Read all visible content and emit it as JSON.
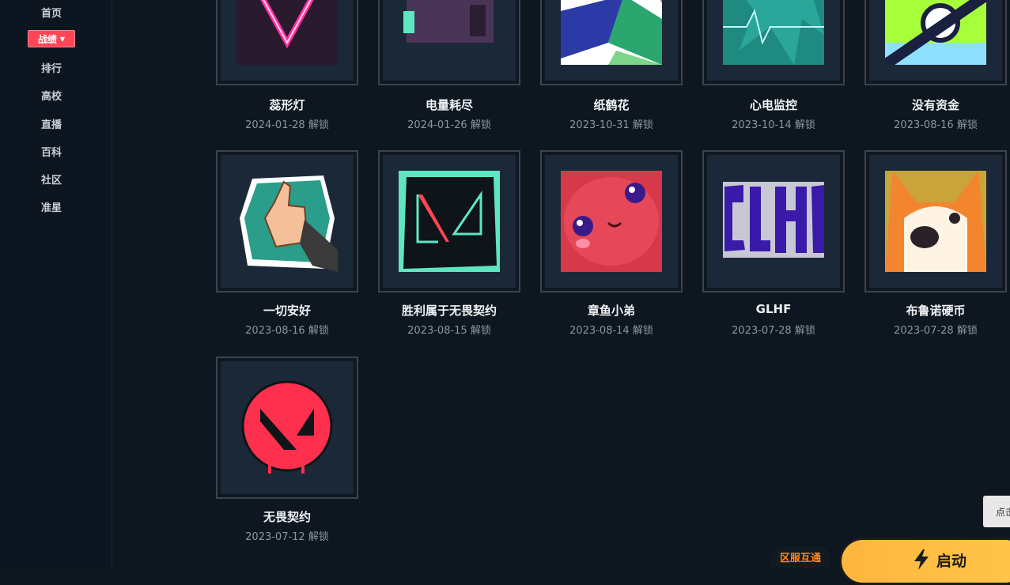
{
  "sidebar": {
    "items": [
      "首页",
      "排行",
      "高校",
      "直播",
      "百科",
      "社区",
      "准星"
    ],
    "active": "战绩"
  },
  "cards": [
    {
      "name": "蕊形灯",
      "date": "2024-01-28 解锁"
    },
    {
      "name": "电量耗尽",
      "date": "2024-01-26 解锁"
    },
    {
      "name": "纸鹤花",
      "date": "2023-10-31 解锁"
    },
    {
      "name": "心电监控",
      "date": "2023-10-14 解锁"
    },
    {
      "name": "没有资金",
      "date": "2023-08-16 解锁"
    },
    {
      "name": "一切安好",
      "date": "2023-08-16 解锁"
    },
    {
      "name": "胜利属于无畏契约",
      "date": "2023-08-15 解锁"
    },
    {
      "name": "章鱼小弟",
      "date": "2023-08-14 解锁"
    },
    {
      "name": "GLHF",
      "date": "2023-07-28 解锁"
    },
    {
      "name": "布鲁诺硬币",
      "date": "2023-07-28 解锁"
    },
    {
      "name": "无畏契约",
      "date": "2023-07-12 解锁"
    }
  ],
  "float_tab": "点击",
  "server_badge": "区服互通",
  "launch": {
    "label": "启动",
    "icon": "lightning-icon"
  }
}
